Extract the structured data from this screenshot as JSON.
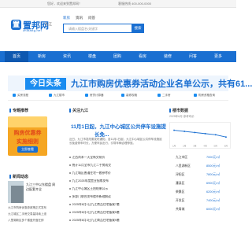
{
  "topbar": {
    "welcome": "您好，欢迎来到置邦网！",
    "hotline": "客服热线 400-000-0000"
  },
  "logo": {
    "mark": "置",
    "name": "置邦网",
    "domain": "zhibang.net"
  },
  "city": "九江",
  "search": {
    "tabs": [
      "新房",
      "资讯",
      "问答"
    ],
    "placeholder": "请输入楼盘名/关键字",
    "button": "搜索"
  },
  "nav": [
    "首页",
    "新房",
    "资讯",
    "楼盘",
    "团购",
    "看房",
    "装修",
    "问答",
    "更多"
  ],
  "banner": {
    "badge": "今日头条",
    "headline": "九江市购房优惠券活动企业名单公示，共有61..."
  },
  "quick_links": [
    "买房流程",
    "九江楼市",
    "房贷计算器",
    "装修攻略",
    "二手房",
    "购房资格查询"
  ],
  "sections": {
    "left_title": "专题推荐",
    "center_title": "关注九江",
    "right_title": "楼市数据",
    "left_news_title": "新闻动态"
  },
  "promo": {
    "line1": "购房优惠券",
    "line2": "实施细则",
    "cta": "立即查看"
  },
  "left_caption": "九江三中以东楼盘 周边配套齐全",
  "left_list": [
    "九江市购房优惠券政策正式发布",
    "九江城区二手房交易量持续上涨",
    "八里湖新区多个楼盘开盘在即"
  ],
  "center": {
    "title": "11月1日起，九江中心城区公共停车设施提",
    "sub": "长免...",
    "summary": "近日，九江市发改委发布通知，自11月1日起，九江中心城区公共停车设施延长免费停车时长，方便市民出行，引导车辆合理停放。",
    "list": [
      "江西尚未一天全新交易价",
      "统计11月全市九江二手房成交",
      "九江城区普通住宅一套参考价",
      "九江2025年度置业指南发布",
      "九江中心城区土拍结果公示",
      "多部门联合发布楼市新政解读",
      "2025年6月1日九江商品住宅备案7套",
      "2025年6月2日九江商品住宅备案5套",
      "2025年6月3日九江商品住宅备案9套"
    ]
  },
  "market": {
    "label": "2025年6月 参考均价",
    "items": [
      {
        "name": "九江市区",
        "value": "7000元/㎡"
      },
      {
        "name": "八里湖新区",
        "value": "8500元/㎡"
      },
      {
        "name": "浔阳区",
        "value": "7800元/㎡"
      },
      {
        "name": "濂溪区",
        "value": "6900元/㎡"
      },
      {
        "name": "柴桑区",
        "value": "6200元/㎡"
      },
      {
        "name": "开发区",
        "value": "7400元/㎡"
      },
      {
        "name": "共青城",
        "value": "6000元/㎡"
      }
    ]
  },
  "chart_data": {
    "type": "line",
    "x": [
      "1月",
      "2月",
      "3月",
      "4月",
      "5月",
      "6月"
    ],
    "series": [
      {
        "values": [
          7600,
          7500,
          7400,
          7300,
          7200,
          7000
        ]
      }
    ],
    "ylim": [
      6500,
      8000
    ]
  },
  "colors": {
    "brand": "#1a6fd1",
    "nav_bg": "#1a6fd1",
    "promo_bg": "#f5a623"
  }
}
